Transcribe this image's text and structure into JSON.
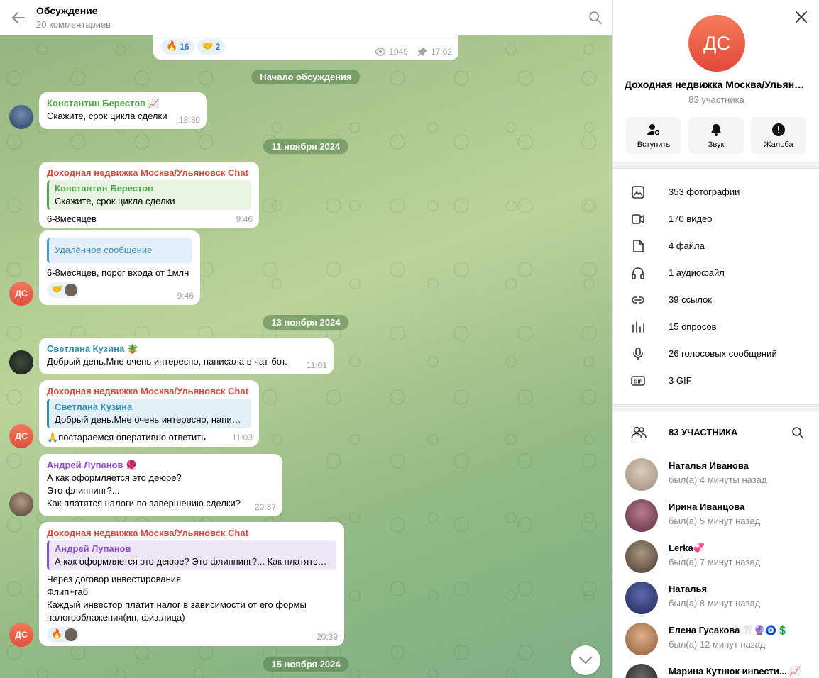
{
  "header": {
    "title": "Обсуждение",
    "subtitle": "20 комментариев"
  },
  "post_footer": {
    "reactions": [
      {
        "emoji": "🔥",
        "count": "16"
      },
      {
        "emoji": "🤝",
        "count": "2"
      }
    ],
    "views": "1049",
    "time": "17:02"
  },
  "service": {
    "discussion_start": "Начало обсуждения",
    "dates": [
      "11 ноября 2024",
      "13 ноября 2024",
      "15 ноября 2024"
    ]
  },
  "messages": [
    {
      "sender": "Константин Берестов",
      "sender_emoji": "📈",
      "text": "Скажите, срок цикла сделки",
      "time": "18:30"
    },
    {
      "sender": "Доходная недвижка Москва/Ульяновск Chat",
      "quote_name": "Константин Берестов",
      "quote_text": "Скажите, срок цикла сделки",
      "text": "6-8месяцев",
      "time": "9:46"
    },
    {
      "quote_text": "Удалённое сообщение",
      "text": "6-8месяцев, порог входа от 1млн",
      "reaction_emoji": "🤝",
      "time": "9:46"
    },
    {
      "sender": "Светлана Кузина",
      "sender_emoji": "🪴",
      "text": "Добрый день.Мне очень интересно, написала в чат-бот.",
      "time": "11:01"
    },
    {
      "sender": "Доходная недвижка Москва/Ульяновск Chat",
      "quote_name": "Светлана Кузина",
      "quote_text": "Добрый день.Мне очень интересно, написала в чат-бот.",
      "text_emoji": "🙏",
      "text": "постараемся оперативно ответить",
      "time": "11:03"
    },
    {
      "sender": "Андрей Лупанов",
      "sender_emoji": "🧶",
      "lines": [
        "А как оформляется это деюре?",
        "Это флиппинг?...",
        "Как платятся налоги по завершению сделки?"
      ],
      "time": "20:37"
    },
    {
      "sender": "Доходная недвижка Москва/Ульяновск Chat",
      "quote_name": "Андрей Лупанов",
      "quote_text": "А как оформляется это деюре? Это флиппинг?...  Как платятся налоги по завершению сделки?",
      "lines": [
        "Через договор инвестирования",
        "Флип+габ",
        "Каждый инвестор платит налог в зависимости от его формы",
        "налогооблажения(ип, физ.лица)"
      ],
      "reaction_emoji": "🔥",
      "time": "20:39"
    }
  ],
  "avatar_initials": "ДС",
  "panel": {
    "avatar_initials": "ДС",
    "name": "Доходная недвижка Москва/Ульяновск Chat",
    "subtitle": "83 участника",
    "actions": [
      {
        "label": "Вступить",
        "icon": "add-user-icon"
      },
      {
        "label": "Звук",
        "icon": "bell-icon"
      },
      {
        "label": "Жалоба",
        "icon": "report-icon"
      }
    ],
    "media": [
      {
        "label": "353 фотографии",
        "icon": "photo-icon"
      },
      {
        "label": "170 видео",
        "icon": "video-icon"
      },
      {
        "label": "4 файла",
        "icon": "file-icon"
      },
      {
        "label": "1 аудиофайл",
        "icon": "headphones-icon"
      },
      {
        "label": "39 ссылок",
        "icon": "link-icon"
      },
      {
        "label": "15 опросов",
        "icon": "poll-icon"
      },
      {
        "label": "26 голосовых сообщений",
        "icon": "microphone-icon"
      },
      {
        "label": "3 GIF",
        "icon": "gif-icon"
      }
    ],
    "members_title": "83 УЧАСТНИКА",
    "members": [
      {
        "name": "Наталья Иванова",
        "status": "был(а) 4 минуты назад",
        "avatar_color": "#c9b9a9"
      },
      {
        "name": "Ирина Иванцова",
        "status": "был(а) 5 минут назад",
        "avatar_color": "#8e4f6a"
      },
      {
        "name": "Lerka",
        "name_emoji": "💞",
        "status": "был(а) 7 минут назад",
        "avatar_color": "#7a6a5a"
      },
      {
        "name": "Наталья",
        "status": "был(а) 8 минут назад",
        "avatar_color": "#2b3a7a"
      },
      {
        "name": "Елена Гусакова",
        "name_emoji": "🦷🔮🧿💲",
        "status": "был(а) 12 минут назад",
        "avatar_color": "#c48a5a"
      },
      {
        "name": "Марина Кутнюк инвести...",
        "name_emoji": "📈",
        "status": "",
        "avatar_color": "#3a3a3a"
      }
    ]
  }
}
